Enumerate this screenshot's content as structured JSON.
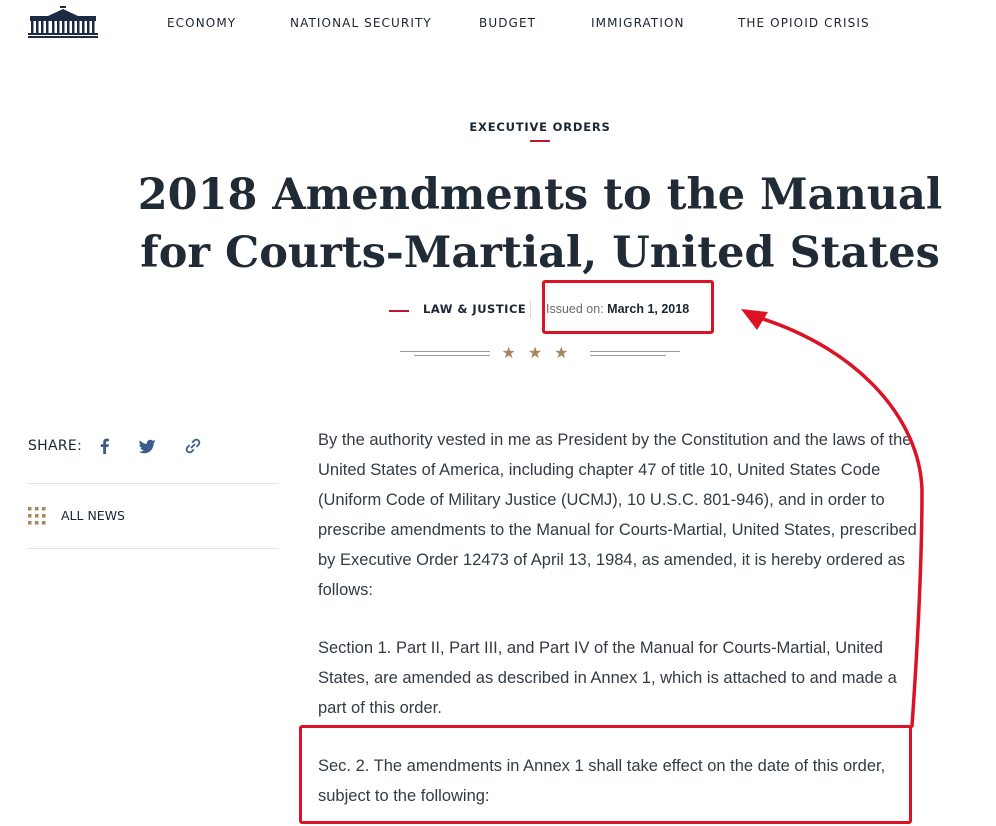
{
  "header": {
    "logo_icon": "white-house-icon",
    "nav": [
      {
        "label": "ECONOMY"
      },
      {
        "label": "NATIONAL SECURITY"
      },
      {
        "label": "BUDGET"
      },
      {
        "label": "IMMIGRATION"
      },
      {
        "label": "THE OPIOID CRISIS"
      }
    ]
  },
  "article": {
    "eyebrow": "EXECUTIVE ORDERS",
    "title_line1": "2018 Amendments to the Manual",
    "title_line2": "for Courts-Martial, United States",
    "category": "LAW & JUSTICE",
    "issued_label": "Issued on:",
    "issued_date": "March 1, 2018",
    "divider_stars": "★★★",
    "paragraphs": [
      "By the authority vested in me as President by the Constitution and the laws of the United States of America, including chapter 47 of title 10, United States Code (Uniform Code of Military Justice (UCMJ), 10 U.S.C. 801-946), and in order to prescribe amendments to the Manual for Courts-Martial, United States, prescribed by Executive Order 12473 of April 13, 1984, as amended, it is hereby ordered as follows:",
      "Section 1.  Part II, Part III, and Part IV of the Manual for Courts-Martial, United States, are amended as described in Annex 1, which is attached to and made a part of this order.",
      "Sec. 2.  The amendments in Annex 1 shall take effect on the date of this order, subject to the following:"
    ]
  },
  "sidebar": {
    "share_label": "SHARE:",
    "share_icons": [
      "facebook-icon",
      "twitter-icon",
      "link-icon"
    ],
    "all_news_label": "ALL NEWS",
    "all_news_icon": "grid-icon"
  },
  "colors": {
    "accent_red": "#c0162e",
    "annotation_red": "#dc1324",
    "star_gold": "#a8865d",
    "navy": "#1c2533",
    "share_blue": "#3b5b8c"
  }
}
